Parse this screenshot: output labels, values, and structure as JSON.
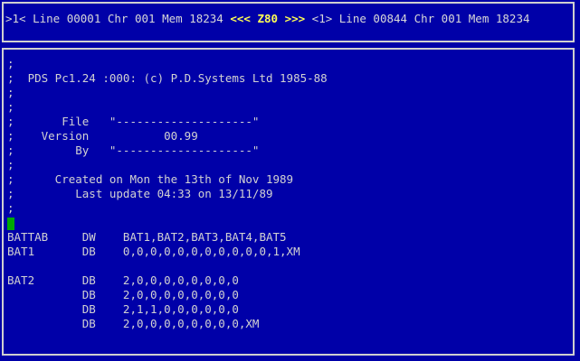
{
  "status_bar": {
    "left_pane": ">1< Line 00001 Chr 001 Mem 18234 ",
    "mode_left": "<<< ",
    "mode": "Z80",
    "mode_right": " >>>",
    "right_pane": " <1> Line 00844 Chr 001 Mem 18234"
  },
  "editor": {
    "lines": [
      ";",
      ";  PDS Pc1.24 :000: (c) P.D.Systems Ltd 1985-88",
      ";",
      ";",
      ";       File   \"--------------------\"",
      ";    Version           00.99",
      ";         By   \"--------------------\"",
      ";",
      ";      Created on Mon the 13th of Nov 1989",
      ";         Last update 04:33 on 13/11/89",
      ";",
      "",
      "BATTAB     DW    BAT1,BAT2,BAT3,BAT4,BAT5",
      "BAT1       DB    0,0,0,0,0,0,0,0,0,0,0,1,XM",
      "",
      "BAT2       DB    2,0,0,0,0,0,0,0,0",
      "           DB    2,0,0,0,0,0,0,0,0",
      "           DB    2,1,1,0,0,0,0,0,0",
      "           DB    2,0,0,0,0,0,0,0,0,XM"
    ]
  },
  "colors": {
    "background": "#0000a8",
    "text": "#d2d2d2",
    "mode_highlight": "#ffff55",
    "cursor": "#00a800"
  }
}
